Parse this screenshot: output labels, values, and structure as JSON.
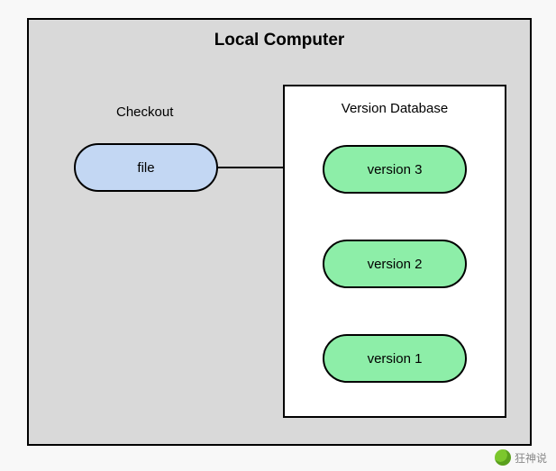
{
  "container": {
    "title": "Local Computer"
  },
  "checkout": {
    "label": "Checkout",
    "file_label": "file"
  },
  "database": {
    "title": "Version Database",
    "versions": {
      "v3": "version 3",
      "v2": "version 2",
      "v1": "version 1"
    }
  },
  "watermark": {
    "text": "狂神说"
  }
}
